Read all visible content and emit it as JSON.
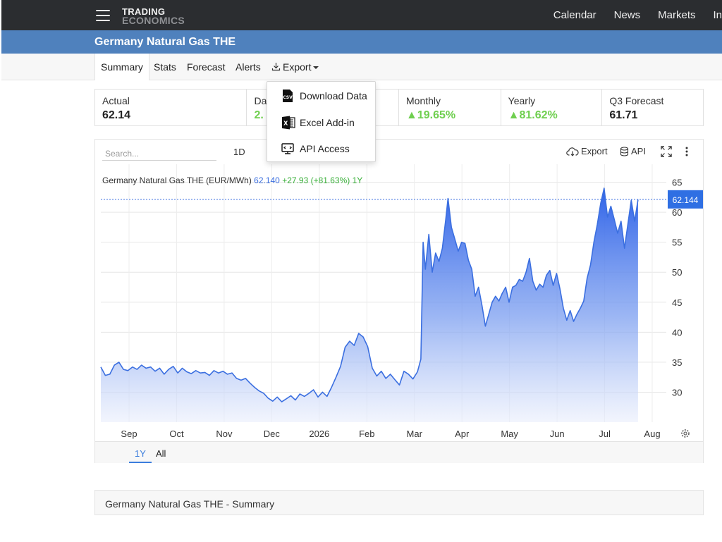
{
  "nav": {
    "logo_top": "TRADING",
    "logo_bottom": "ECONOMICS",
    "links": [
      "Calendar",
      "News",
      "Markets",
      "In"
    ]
  },
  "page_title": "Germany Natural Gas THE",
  "tabs": {
    "summary": "Summary",
    "stats": "Stats",
    "forecast": "Forecast",
    "alerts": "Alerts",
    "export": "Export"
  },
  "export_menu": {
    "download": "Download Data",
    "excel": "Excel Add-in",
    "api": "API Access"
  },
  "stats": [
    {
      "label": "Actual",
      "value": "62.14"
    },
    {
      "label": "Da",
      "value": "2."
    },
    {
      "label": "",
      "value": ""
    },
    {
      "label": "Monthly",
      "value": "▲19.65%"
    },
    {
      "label": "Yearly",
      "value": "▲81.62%"
    },
    {
      "label": "Q3 Forecast",
      "value": "61.71"
    }
  ],
  "toolbar": {
    "search_placeholder": "Search...",
    "range_1d": "1D",
    "export": "Export",
    "api": "API"
  },
  "chart_header": {
    "name": "Germany Natural Gas THE (EUR/MWh)",
    "last": "62.140",
    "change": "+27.93 (+81.63%)",
    "period": "1Y"
  },
  "last_price_tag": "62.144",
  "footer_tabs": {
    "y1": "1Y",
    "all": "All"
  },
  "summary_title": "Germany Natural Gas THE - Summary",
  "colors": {
    "nav_bg": "#2b2d30",
    "title_bg": "#4f81bd",
    "line": "#3b6fe0",
    "up": "#6fcf4f",
    "accent": "#3b7ddd"
  },
  "chart_data": {
    "type": "area",
    "title": "Germany Natural Gas THE (EUR/MWh)",
    "x_labels": [
      "Sep",
      "Oct",
      "Nov",
      "Dec",
      "2026",
      "Feb",
      "Mar",
      "Apr",
      "May",
      "Jun",
      "Jul",
      "Aug"
    ],
    "y_ticks": [
      30,
      35,
      40,
      45,
      50,
      55,
      60,
      65
    ],
    "ylim": [
      25,
      68
    ],
    "xlim": [
      0,
      1
    ],
    "series": [
      {
        "name": "Germany Natural Gas THE",
        "points": [
          [
            0.0,
            34.2
          ],
          [
            0.008,
            32.8
          ],
          [
            0.016,
            33.0
          ],
          [
            0.024,
            34.5
          ],
          [
            0.032,
            35.0
          ],
          [
            0.04,
            33.8
          ],
          [
            0.048,
            33.6
          ],
          [
            0.056,
            34.2
          ],
          [
            0.064,
            33.8
          ],
          [
            0.072,
            34.5
          ],
          [
            0.08,
            34.0
          ],
          [
            0.088,
            34.2
          ],
          [
            0.096,
            33.5
          ],
          [
            0.104,
            34.0
          ],
          [
            0.112,
            33.0
          ],
          [
            0.12,
            33.8
          ],
          [
            0.128,
            34.3
          ],
          [
            0.136,
            33.2
          ],
          [
            0.144,
            34.0
          ],
          [
            0.152,
            33.4
          ],
          [
            0.16,
            33.1
          ],
          [
            0.168,
            33.6
          ],
          [
            0.176,
            33.2
          ],
          [
            0.184,
            33.3
          ],
          [
            0.192,
            32.8
          ],
          [
            0.2,
            33.6
          ],
          [
            0.208,
            33.2
          ],
          [
            0.216,
            33.5
          ],
          [
            0.224,
            33.0
          ],
          [
            0.232,
            33.2
          ],
          [
            0.24,
            32.3
          ],
          [
            0.248,
            32.0
          ],
          [
            0.256,
            32.3
          ],
          [
            0.264,
            31.5
          ],
          [
            0.272,
            30.8
          ],
          [
            0.28,
            30.2
          ],
          [
            0.288,
            29.8
          ],
          [
            0.296,
            29.0
          ],
          [
            0.304,
            28.5
          ],
          [
            0.312,
            29.2
          ],
          [
            0.32,
            28.4
          ],
          [
            0.328,
            28.9
          ],
          [
            0.336,
            29.4
          ],
          [
            0.344,
            28.7
          ],
          [
            0.352,
            29.7
          ],
          [
            0.36,
            29.3
          ],
          [
            0.368,
            29.8
          ],
          [
            0.376,
            30.4
          ],
          [
            0.384,
            29.2
          ],
          [
            0.392,
            30.0
          ],
          [
            0.4,
            29.3
          ],
          [
            0.408,
            30.8
          ],
          [
            0.416,
            32.5
          ],
          [
            0.424,
            34.3
          ],
          [
            0.432,
            37.5
          ],
          [
            0.44,
            38.5
          ],
          [
            0.448,
            37.8
          ],
          [
            0.456,
            39.8
          ],
          [
            0.464,
            39.2
          ],
          [
            0.472,
            37.6
          ],
          [
            0.48,
            34.0
          ],
          [
            0.488,
            32.7
          ],
          [
            0.496,
            33.5
          ],
          [
            0.504,
            32.3
          ],
          [
            0.512,
            33.0
          ],
          [
            0.52,
            32.1
          ],
          [
            0.528,
            31.2
          ],
          [
            0.536,
            33.5
          ],
          [
            0.544,
            33.0
          ],
          [
            0.552,
            32.2
          ],
          [
            0.56,
            33.4
          ],
          [
            0.566,
            35.5
          ],
          [
            0.57,
            55.0
          ],
          [
            0.574,
            50.5
          ],
          [
            0.58,
            56.3
          ],
          [
            0.586,
            50.0
          ],
          [
            0.592,
            53.2
          ],
          [
            0.598,
            51.8
          ],
          [
            0.604,
            54.0
          ],
          [
            0.61,
            58.8
          ],
          [
            0.614,
            62.3
          ],
          [
            0.62,
            57.5
          ],
          [
            0.626,
            55.5
          ],
          [
            0.632,
            53.5
          ],
          [
            0.638,
            55.0
          ],
          [
            0.644,
            54.8
          ],
          [
            0.65,
            52.0
          ],
          [
            0.656,
            50.5
          ],
          [
            0.662,
            46.0
          ],
          [
            0.668,
            47.5
          ],
          [
            0.674,
            44.5
          ],
          [
            0.68,
            41.0
          ],
          [
            0.686,
            43.0
          ],
          [
            0.692,
            45.0
          ],
          [
            0.698,
            46.0
          ],
          [
            0.704,
            45.2
          ],
          [
            0.71,
            46.5
          ],
          [
            0.716,
            47.5
          ],
          [
            0.722,
            45.0
          ],
          [
            0.728,
            47.5
          ],
          [
            0.734,
            47.8
          ],
          [
            0.74,
            48.8
          ],
          [
            0.746,
            48.5
          ],
          [
            0.752,
            50.0
          ],
          [
            0.758,
            52.3
          ],
          [
            0.764,
            48.5
          ],
          [
            0.77,
            47.0
          ],
          [
            0.776,
            48.0
          ],
          [
            0.782,
            47.5
          ],
          [
            0.788,
            49.5
          ],
          [
            0.794,
            50.3
          ],
          [
            0.8,
            47.8
          ],
          [
            0.806,
            49.8
          ],
          [
            0.812,
            47.2
          ],
          [
            0.818,
            44.0
          ],
          [
            0.824,
            42.0
          ],
          [
            0.83,
            43.6
          ],
          [
            0.836,
            41.8
          ],
          [
            0.842,
            43.0
          ],
          [
            0.848,
            44.0
          ],
          [
            0.854,
            45.2
          ],
          [
            0.86,
            49.0
          ],
          [
            0.866,
            51.2
          ],
          [
            0.872,
            55.0
          ],
          [
            0.878,
            58.0
          ],
          [
            0.884,
            61.5
          ],
          [
            0.89,
            64.0
          ],
          [
            0.896,
            59.2
          ],
          [
            0.902,
            61.0
          ],
          [
            0.908,
            58.8
          ],
          [
            0.914,
            56.5
          ],
          [
            0.92,
            58.5
          ],
          [
            0.926,
            54.0
          ],
          [
            0.932,
            58.0
          ],
          [
            0.938,
            62.0
          ],
          [
            0.944,
            58.5
          ],
          [
            0.95,
            62.1
          ]
        ]
      }
    ],
    "last_value": 62.144,
    "grid": "horizontal and vertical",
    "legend": "none"
  }
}
